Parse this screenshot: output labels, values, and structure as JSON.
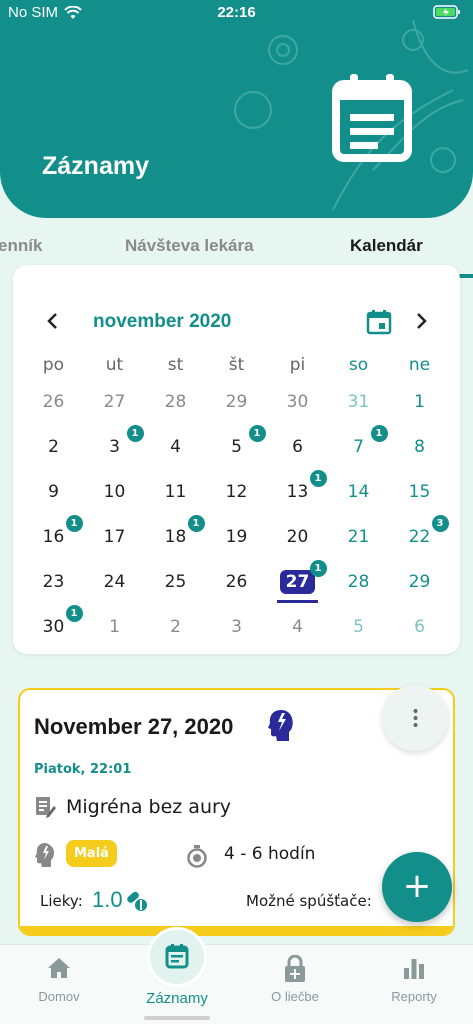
{
  "status_bar": {
    "carrier": "No SIM",
    "time": "22:16"
  },
  "header": {
    "title": "Záznamy",
    "icon": "calendar-note-icon"
  },
  "tabs": [
    {
      "label": "enník",
      "active": false
    },
    {
      "label": "Návšteva lekára",
      "active": false
    },
    {
      "label": "Kalendár",
      "active": true
    }
  ],
  "calendar": {
    "month_label": "november 2020",
    "weekdays": [
      "po",
      "ut",
      "st",
      "št",
      "pi",
      "so",
      "ne"
    ],
    "weeks": [
      [
        {
          "d": "26",
          "o": true
        },
        {
          "d": "27",
          "o": true
        },
        {
          "d": "28",
          "o": true
        },
        {
          "d": "29",
          "o": true
        },
        {
          "d": "30",
          "o": true
        },
        {
          "d": "31",
          "o": true
        },
        {
          "d": "1"
        }
      ],
      [
        {
          "d": "2"
        },
        {
          "d": "3",
          "b": "1"
        },
        {
          "d": "4"
        },
        {
          "d": "5",
          "b": "1"
        },
        {
          "d": "6"
        },
        {
          "d": "7",
          "b": "1"
        },
        {
          "d": "8"
        }
      ],
      [
        {
          "d": "9"
        },
        {
          "d": "10"
        },
        {
          "d": "11"
        },
        {
          "d": "12"
        },
        {
          "d": "13",
          "b": "1"
        },
        {
          "d": "14"
        },
        {
          "d": "15"
        }
      ],
      [
        {
          "d": "16",
          "b": "1"
        },
        {
          "d": "17"
        },
        {
          "d": "18",
          "b": "1"
        },
        {
          "d": "19"
        },
        {
          "d": "20"
        },
        {
          "d": "21"
        },
        {
          "d": "22",
          "b": "3"
        }
      ],
      [
        {
          "d": "23"
        },
        {
          "d": "24"
        },
        {
          "d": "25"
        },
        {
          "d": "26"
        },
        {
          "d": "27",
          "b": "1",
          "s": true
        },
        {
          "d": "28"
        },
        {
          "d": "29"
        }
      ],
      [
        {
          "d": "30",
          "b": "1"
        },
        {
          "d": "1",
          "o": true
        },
        {
          "d": "2",
          "o": true
        },
        {
          "d": "3",
          "o": true
        },
        {
          "d": "4",
          "o": true
        },
        {
          "d": "5",
          "o": true
        },
        {
          "d": "6",
          "o": true
        }
      ]
    ]
  },
  "entry": {
    "date": "November 27, 2020",
    "subtitle": "Piatok, 22:01",
    "diagnosis": "Migréna bez aury",
    "pain_level": "Malá",
    "duration": "4 - 6 hodín",
    "meds_label": "Lieky:",
    "meds_value": "1.0",
    "triggers_label": "Možné spúšťače:"
  },
  "nav": [
    {
      "label": "Domov",
      "icon": "home-icon"
    },
    {
      "label": "Záznamy",
      "icon": "notes-icon",
      "active": true
    },
    {
      "label": "O liečbe",
      "icon": "lock-icon"
    },
    {
      "label": "Reporty",
      "icon": "bar-chart-icon"
    }
  ],
  "colors": {
    "primary": "#138f8b",
    "accent": "#f5cc1c",
    "selected": "#2a2a9a"
  }
}
